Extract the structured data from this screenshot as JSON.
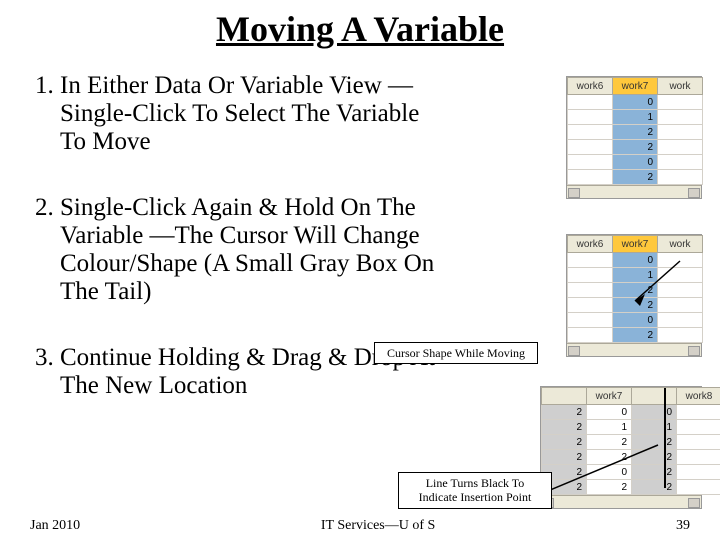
{
  "title": "Moving A Variable",
  "steps": [
    "In Either Data Or Variable View —Single-Click To Select The Variable To Move",
    "Single-Click Again & Hold On The Variable —The Cursor Will Change Colour/Shape (A Small Gray Box On The Tail)",
    "Continue Holding & Drag & Drop At The New Location"
  ],
  "callouts": {
    "cursor_shape": "Cursor Shape While Moving",
    "insertion_line": "Line Turns Black To Indicate Insertion Point"
  },
  "mini1": {
    "headers": [
      "work6",
      "work7",
      "work"
    ],
    "selected_col": 1,
    "rows": [
      [
        "",
        "0",
        ""
      ],
      [
        "",
        "1",
        ""
      ],
      [
        "",
        "2",
        ""
      ],
      [
        "",
        "2",
        ""
      ],
      [
        "",
        "0",
        ""
      ],
      [
        "",
        "2",
        ""
      ]
    ]
  },
  "mini2": {
    "headers": [
      "work6",
      "work7",
      "work"
    ],
    "selected_col": 1,
    "rows": [
      [
        "",
        "0",
        ""
      ],
      [
        "",
        "1",
        ""
      ],
      [
        "",
        "2",
        ""
      ],
      [
        "",
        "2",
        ""
      ],
      [
        "",
        "0",
        ""
      ],
      [
        "",
        "2",
        ""
      ]
    ]
  },
  "mini3": {
    "headers": [
      "",
      "work7",
      "",
      "work8"
    ],
    "gray_cols": [
      0,
      2
    ],
    "rows": [
      [
        "2",
        "0",
        "0",
        ""
      ],
      [
        "2",
        "1",
        "1",
        ""
      ],
      [
        "2",
        "2",
        "2",
        ""
      ],
      [
        "2",
        "2",
        "2",
        ""
      ],
      [
        "2",
        "0",
        "2",
        ""
      ],
      [
        "2",
        "2",
        "2",
        ""
      ]
    ]
  },
  "footer": {
    "left": "Jan 2010",
    "center": "IT Services—U of  S",
    "right": "39"
  }
}
